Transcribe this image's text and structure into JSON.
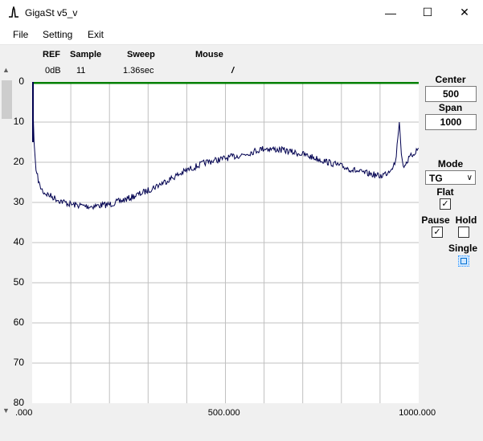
{
  "window": {
    "title": "GigaSt v5_v",
    "minimize_glyph": "—",
    "maximize_glyph": "☐",
    "close_glyph": "✕"
  },
  "menu": [
    "File",
    "Setting",
    "Exit"
  ],
  "header": {
    "ref_label": "REF",
    "sample_label": "Sample",
    "sweep_label": "Sweep",
    "mouse_label": "Mouse",
    "ref_value": "0dB",
    "sample_value": "11",
    "sweep_value": "1.36sec",
    "mouse_value": "/"
  },
  "controls": {
    "center_label": "Center",
    "center_value": "500",
    "span_label": "Span",
    "span_value": "1000",
    "mode_label": "Mode",
    "mode_value": "TG",
    "flat_label": "Flat",
    "flat_checked": true,
    "pause_label": "Pause",
    "pause_checked": true,
    "hold_label": "Hold",
    "hold_checked": false,
    "single_label": "Single"
  },
  "colors": {
    "trace": "#000050",
    "ref_line": "#008000",
    "grid": "#c0c0c0"
  },
  "chart_data": {
    "type": "line",
    "xlim": [
      0,
      1000
    ],
    "ylim": [
      0,
      80
    ],
    "y_inverted": true,
    "grid": true,
    "x_tick_labels": [
      ".000",
      "500.000",
      "1000.000"
    ],
    "y_tick_labels": [
      "0",
      "10",
      "20",
      "30",
      "40",
      "50",
      "60",
      "70",
      "80"
    ],
    "ref_level": 0,
    "series": [
      {
        "x": [
          0,
          5,
          10,
          20,
          30,
          50,
          70,
          100,
          150,
          200,
          250,
          300,
          350,
          400,
          450,
          500,
          550,
          600,
          650,
          700,
          750,
          800,
          850,
          880,
          900,
          920,
          940,
          950,
          955,
          960,
          980,
          1000
        ],
        "y": [
          0,
          15,
          22,
          26,
          27.5,
          28.5,
          29.5,
          30.5,
          31,
          30.5,
          29,
          27,
          24.5,
          22,
          20,
          19,
          18,
          16.5,
          17,
          18,
          19.5,
          21,
          22.5,
          23,
          23.5,
          22.5,
          20,
          10,
          18,
          21,
          18.5,
          16.5
        ]
      }
    ]
  }
}
